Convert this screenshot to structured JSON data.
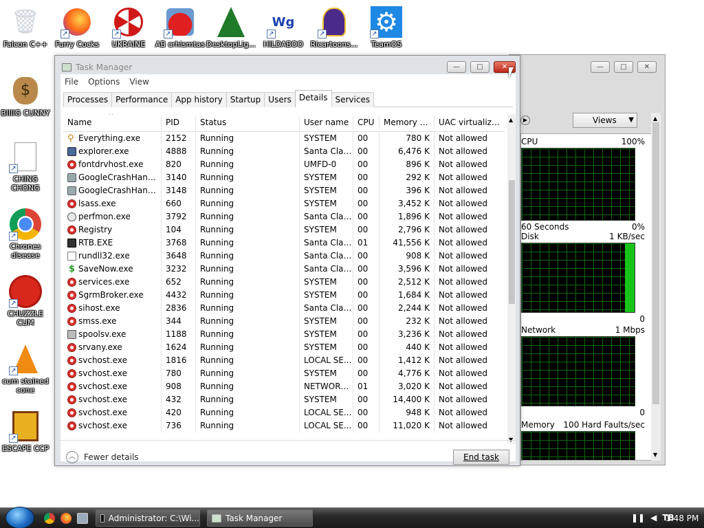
{
  "desktop": {
    "icons": [
      {
        "label": "Falcon C++",
        "glyph": "recycle-bin-icon"
      },
      {
        "label": "Furry Cocks",
        "glyph": "firefox-icon"
      },
      {
        "label": "UKRAINE",
        "glyph": "radiation-icon"
      },
      {
        "label": "AB crhismtas",
        "glyph": "angry-bird-icon"
      },
      {
        "label": "DesktopLig...",
        "glyph": "christmas-tree-icon"
      },
      {
        "label": "HILDABOO",
        "glyph": "wg-icon"
      },
      {
        "label": "Ricartoons...",
        "glyph": "ninja-icon"
      },
      {
        "label": "TeamOS",
        "glyph": "gear-icon"
      },
      {
        "label": "BIIIIG CUNNY",
        "glyph": "money-bag-icon"
      },
      {
        "label": "CHING CHONG",
        "glyph": "blank-file-icon"
      },
      {
        "label": "Chrones disease",
        "glyph": "chrome-icon"
      },
      {
        "label": "CHUZZLE CUM",
        "glyph": "chuzzle-icon"
      },
      {
        "label": "cum stained cone",
        "glyph": "vlc-cone-icon"
      },
      {
        "label": "ESCAPE CCP",
        "glyph": "escape-icon"
      }
    ]
  },
  "perf_window": {
    "views_label": "Views",
    "graphs": [
      {
        "name": "CPU",
        "max": "100%",
        "footer_left": "60 Seconds",
        "footer_right": "0%"
      },
      {
        "name": "Disk",
        "max": "1 KB/sec",
        "footer_right": "0"
      },
      {
        "name": "Network",
        "max": "1 Mbps",
        "footer_right": "0"
      },
      {
        "name": "Memory",
        "max": "100 Hard Faults/sec"
      }
    ]
  },
  "task_manager": {
    "title": "Task Manager",
    "menu": [
      "File",
      "Options",
      "View"
    ],
    "tabs": [
      "Processes",
      "Performance",
      "App history",
      "Startup",
      "Users",
      "Details",
      "Services"
    ],
    "active_tab": "Details",
    "columns": [
      "Name",
      "PID",
      "Status",
      "User name",
      "CPU",
      "Memory (a...",
      "UAC virtualizat..."
    ],
    "rows": [
      {
        "name": "Everything.exe",
        "pid": "2152",
        "status": "Running",
        "user": "SYSTEM",
        "cpu": "00",
        "mem": "780 K",
        "uac": "Not allowed",
        "icon": "key"
      },
      {
        "name": "explorer.exe",
        "pid": "4888",
        "status": "Running",
        "user": "Santa Claus",
        "cpu": "00",
        "mem": "6,476 K",
        "uac": "Not allowed",
        "icon": "sq"
      },
      {
        "name": "fontdrvhost.exe",
        "pid": "820",
        "status": "Running",
        "user": "UMFD-0",
        "cpu": "00",
        "mem": "896 K",
        "uac": "Not allowed",
        "icon": "w"
      },
      {
        "name": "GoogleCrashHandler...",
        "pid": "3140",
        "status": "Running",
        "user": "SYSTEM",
        "cpu": "00",
        "mem": "292 K",
        "uac": "Not allowed",
        "icon": "gr"
      },
      {
        "name": "GoogleCrashHandler...",
        "pid": "3148",
        "status": "Running",
        "user": "SYSTEM",
        "cpu": "00",
        "mem": "396 K",
        "uac": "Not allowed",
        "icon": "gr"
      },
      {
        "name": "lsass.exe",
        "pid": "660",
        "status": "Running",
        "user": "SYSTEM",
        "cpu": "00",
        "mem": "3,452 K",
        "uac": "Not allowed",
        "icon": "w"
      },
      {
        "name": "perfmon.exe",
        "pid": "3792",
        "status": "Running",
        "user": "Santa Claus",
        "cpu": "00",
        "mem": "1,896 K",
        "uac": "Not allowed",
        "icon": "gauge"
      },
      {
        "name": "Registry",
        "pid": "104",
        "status": "Running",
        "user": "SYSTEM",
        "cpu": "00",
        "mem": "2,796 K",
        "uac": "Not allowed",
        "icon": "w"
      },
      {
        "name": "RTB.EXE",
        "pid": "3768",
        "status": "Running",
        "user": "Santa Claus",
        "cpu": "01",
        "mem": "41,556 K",
        "uac": "Not allowed",
        "icon": "rtb"
      },
      {
        "name": "rundll32.exe",
        "pid": "3648",
        "status": "Running",
        "user": "Santa Claus",
        "cpu": "00",
        "mem": "908 K",
        "uac": "Not allowed",
        "icon": "doc"
      },
      {
        "name": "SaveNow.exe",
        "pid": "3232",
        "status": "Running",
        "user": "Santa Claus",
        "cpu": "00",
        "mem": "3,596 K",
        "uac": "Not allowed",
        "icon": "dol"
      },
      {
        "name": "services.exe",
        "pid": "652",
        "status": "Running",
        "user": "SYSTEM",
        "cpu": "00",
        "mem": "2,512 K",
        "uac": "Not allowed",
        "icon": "w"
      },
      {
        "name": "SgrmBroker.exe",
        "pid": "4432",
        "status": "Running",
        "user": "SYSTEM",
        "cpu": "00",
        "mem": "1,684 K",
        "uac": "Not allowed",
        "icon": "w"
      },
      {
        "name": "sihost.exe",
        "pid": "2836",
        "status": "Running",
        "user": "Santa Claus",
        "cpu": "00",
        "mem": "2,244 K",
        "uac": "Not allowed",
        "icon": "w"
      },
      {
        "name": "smss.exe",
        "pid": "344",
        "status": "Running",
        "user": "SYSTEM",
        "cpu": "00",
        "mem": "232 K",
        "uac": "Not allowed",
        "icon": "w"
      },
      {
        "name": "spoolsv.exe",
        "pid": "1188",
        "status": "Running",
        "user": "SYSTEM",
        "cpu": "00",
        "mem": "3,236 K",
        "uac": "Not allowed",
        "icon": "prn"
      },
      {
        "name": "srvany.exe",
        "pid": "1624",
        "status": "Running",
        "user": "SYSTEM",
        "cpu": "00",
        "mem": "440 K",
        "uac": "Not allowed",
        "icon": "w"
      },
      {
        "name": "svchost.exe",
        "pid": "1816",
        "status": "Running",
        "user": "LOCAL SE...",
        "cpu": "00",
        "mem": "1,412 K",
        "uac": "Not allowed",
        "icon": "w"
      },
      {
        "name": "svchost.exe",
        "pid": "780",
        "status": "Running",
        "user": "SYSTEM",
        "cpu": "00",
        "mem": "4,776 K",
        "uac": "Not allowed",
        "icon": "w"
      },
      {
        "name": "svchost.exe",
        "pid": "908",
        "status": "Running",
        "user": "NETWORK...",
        "cpu": "01",
        "mem": "3,020 K",
        "uac": "Not allowed",
        "icon": "w"
      },
      {
        "name": "svchost.exe",
        "pid": "432",
        "status": "Running",
        "user": "SYSTEM",
        "cpu": "00",
        "mem": "14,400 K",
        "uac": "Not allowed",
        "icon": "w"
      },
      {
        "name": "svchost.exe",
        "pid": "420",
        "status": "Running",
        "user": "LOCAL SE...",
        "cpu": "00",
        "mem": "948 K",
        "uac": "Not allowed",
        "icon": "w"
      },
      {
        "name": "svchost.exe",
        "pid": "736",
        "status": "Running",
        "user": "LOCAL SE...",
        "cpu": "00",
        "mem": "11,020 K",
        "uac": "Not allowed",
        "icon": "w"
      }
    ],
    "fewer_details": "Fewer details",
    "end_task": "End task"
  },
  "taskbar": {
    "buttons": [
      "Administrator: C:\\Wi...",
      "Task Manager"
    ],
    "clock": "1:48 PM"
  }
}
